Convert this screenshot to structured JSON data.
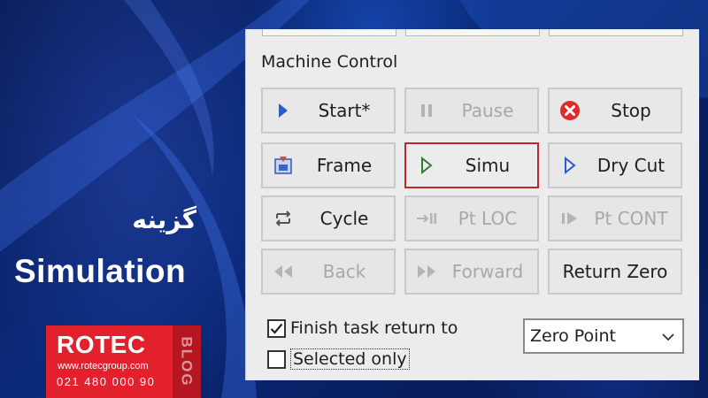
{
  "overlay": {
    "persian_title": "گزینه",
    "main_title": "Simulation"
  },
  "logo": {
    "brand": "ROTEC",
    "website": "www.rotecgroup.com",
    "phone": "021 480 000 90",
    "tag": "BLOG"
  },
  "machine_control": {
    "group_label": "Machine Control",
    "buttons": [
      {
        "label": "Start*",
        "icon": "play-blue-icon",
        "enabled": true,
        "selected": false
      },
      {
        "label": "Pause",
        "icon": "pause-icon",
        "enabled": false,
        "selected": false
      },
      {
        "label": "Stop",
        "icon": "stop-red-circle-icon",
        "enabled": true,
        "selected": false
      },
      {
        "label": "Frame",
        "icon": "frame-icon",
        "enabled": true,
        "selected": false
      },
      {
        "label": "Simu",
        "icon": "play-outline-green-icon",
        "enabled": true,
        "selected": true
      },
      {
        "label": "Dry Cut",
        "icon": "play-outline-blue-icon",
        "enabled": true,
        "selected": false
      },
      {
        "label": "Cycle",
        "icon": "cycle-icon",
        "enabled": true,
        "selected": false
      },
      {
        "label": "Pt LOC",
        "icon": "point-locate-icon",
        "enabled": false,
        "selected": false
      },
      {
        "label": "Pt CONT",
        "icon": "point-continue-icon",
        "enabled": false,
        "selected": false
      },
      {
        "label": "Back",
        "icon": "back-arrows-icon",
        "enabled": false,
        "selected": false
      },
      {
        "label": "Forward",
        "icon": "forward-arrows-icon",
        "enabled": false,
        "selected": false
      },
      {
        "label": "Return Zero",
        "icon": "",
        "enabled": true,
        "selected": false
      }
    ],
    "finish_task": {
      "label": "Finish task return to",
      "checked": true
    },
    "selected_only": {
      "label": "Selected only",
      "checked": false
    },
    "return_target": {
      "value": "Zero Point"
    }
  },
  "colors": {
    "panel_bg": "#ececec",
    "selected_border": "#c0262d",
    "logo_red": "#e3212d",
    "icon_blue": "#2a5bd7",
    "icon_green": "#2e7d32",
    "stop_red": "#e02b2b"
  }
}
